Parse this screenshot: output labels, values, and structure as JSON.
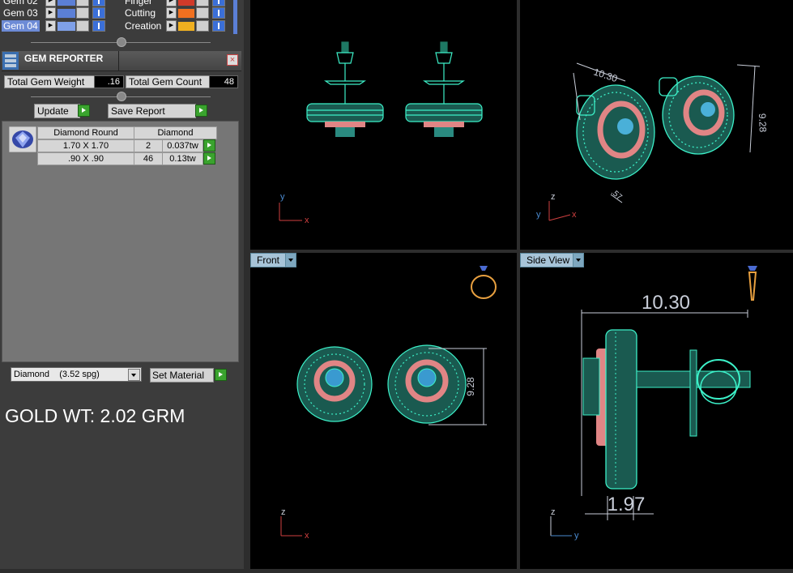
{
  "gems": [
    {
      "label": "Gem 02"
    },
    {
      "label": "Gem 03"
    },
    {
      "label": "Gem 04"
    }
  ],
  "materials": [
    {
      "label": "Finger"
    },
    {
      "label": "Cutting"
    },
    {
      "label": "Creation"
    }
  ],
  "reporter": {
    "title": "GEM REPORTER",
    "close": "×",
    "total_weight_label": "Total Gem Weight",
    "total_weight": ".16",
    "total_count_label": "Total Gem Count",
    "total_count": "48",
    "update_label": "Update",
    "save_label": "Save Report"
  },
  "table": {
    "headers": [
      "Diamond Round",
      "Diamond"
    ],
    "rows": [
      {
        "size": "1.70 X 1.70",
        "count": "2",
        "weight": "0.037tw"
      },
      {
        "size": ".90 X .90",
        "count": "46",
        "weight": "0.13tw"
      }
    ]
  },
  "material": {
    "select": "Diamond    (3.52 spg)",
    "set_label": "Set Material"
  },
  "gold_note": "GOLD WT: 2.02 GRM",
  "viewports": {
    "front_label": "Front",
    "side_label": "Side View"
  },
  "dims": {
    "persp_a": "10.30",
    "persp_b": "9.28",
    "persp_c": ".57",
    "front": "9.28",
    "side_top": "10.30",
    "side_bottom": "1.97"
  },
  "axes": {
    "x": "x",
    "y": "y",
    "z": "z"
  },
  "colors": {
    "gem_fill": "#5b7fd6",
    "cyan": "#3cf0c8",
    "pink": "#e08585",
    "cutting": "#f07020",
    "creation": "#f0b020",
    "finger": "#d03a2a",
    "dim": "#c8cdd8"
  }
}
